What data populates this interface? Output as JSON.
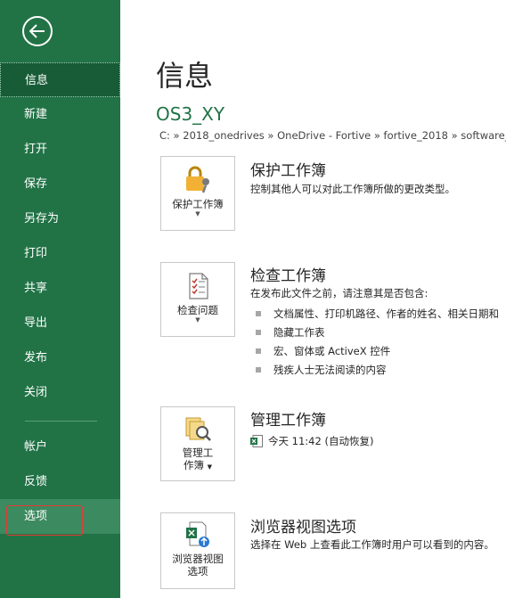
{
  "sidebar": {
    "items": [
      {
        "label": "信息"
      },
      {
        "label": "新建"
      },
      {
        "label": "打开"
      },
      {
        "label": "保存"
      },
      {
        "label": "另存为"
      },
      {
        "label": "打印"
      },
      {
        "label": "共享"
      },
      {
        "label": "导出"
      },
      {
        "label": "发布"
      },
      {
        "label": "关闭"
      }
    ],
    "bottom_items": [
      {
        "label": "帐户"
      },
      {
        "label": "反馈"
      },
      {
        "label": "选项"
      }
    ]
  },
  "main": {
    "title": "信息",
    "file_name": "OS3_XY",
    "path": "C: » 2018_onedrives » OneDrive - Fortive » fortive_2018 » software_",
    "protect": {
      "tile_label": "保护工作簿",
      "title": "保护工作簿",
      "desc": "控制其他人可以对此工作簿所做的更改类型。"
    },
    "inspect": {
      "tile_label": "检查问题",
      "title": "检查工作簿",
      "desc": "在发布此文件之前，请注意其是否包含:",
      "bullets": [
        "文档属性、打印机路径、作者的姓名、相关日期和",
        "隐藏工作表",
        "宏、窗体或 ActiveX 控件",
        "残疾人士无法阅读的内容"
      ]
    },
    "manage": {
      "tile_label_1": "管理工",
      "tile_label_2": "作簿",
      "title": "管理工作簿",
      "version": "今天 11:42 (自动恢复)"
    },
    "browser": {
      "tile_label_1": "浏览器视图",
      "tile_label_2": "选项",
      "title": "浏览器视图选项",
      "desc": "选择在 Web 上查看此工作簿时用户可以看到的内容。"
    }
  },
  "colors": {
    "accent": "#217346",
    "active": "#185c37",
    "selected": "#3c8a5f",
    "highlight": "#e53935"
  }
}
